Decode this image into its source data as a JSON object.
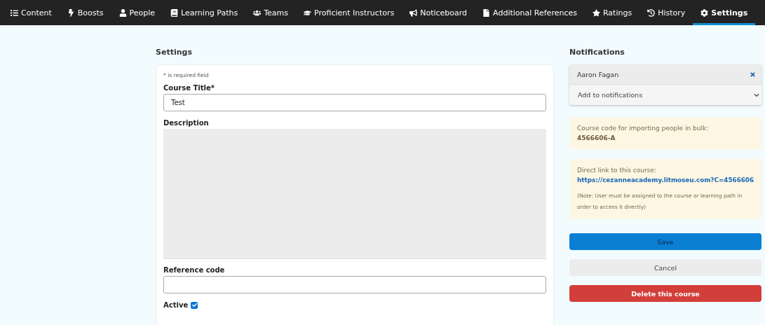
{
  "nav": {
    "tabs": [
      {
        "label": "Content",
        "selected": false
      },
      {
        "label": "Boosts",
        "selected": false
      },
      {
        "label": "People",
        "selected": false
      },
      {
        "label": "Learning Paths",
        "selected": false
      },
      {
        "label": "Teams",
        "selected": false
      },
      {
        "label": "Proficient Instructors",
        "selected": false
      },
      {
        "label": "Noticeboard",
        "selected": false
      },
      {
        "label": "Additional References",
        "selected": false
      },
      {
        "label": "Ratings",
        "selected": false
      },
      {
        "label": "History",
        "selected": false
      },
      {
        "label": "Settings",
        "selected": true
      }
    ]
  },
  "settings": {
    "heading": "Settings",
    "required_note": "* is required field",
    "course_title": {
      "label": "Course Title*",
      "value": "Test"
    },
    "description": {
      "label": "Description"
    },
    "reference_code": {
      "label": "Reference code"
    },
    "active": {
      "label": "Active",
      "checked": true
    }
  },
  "notifications": {
    "heading": "Notifications",
    "recipients": [
      "Aaron Fagan"
    ],
    "add_select": "Add to notifications"
  },
  "course_code": {
    "label": "Course code for importing people in bulk:",
    "value": "4566606-A"
  },
  "direct_link": {
    "label": "Direct link to this course:",
    "url": "https://cezanneacademy.litmoseu.com?C=4566606",
    "note": "(Note: User must be assigned to the course or learning path in order to access it directly)"
  },
  "buttons": [
    {
      "label": "Save",
      "kind": "primary"
    },
    {
      "label": "Cancel",
      "kind": "secondary"
    },
    {
      "label": "Delete this course",
      "kind": "danger"
    }
  ]
}
